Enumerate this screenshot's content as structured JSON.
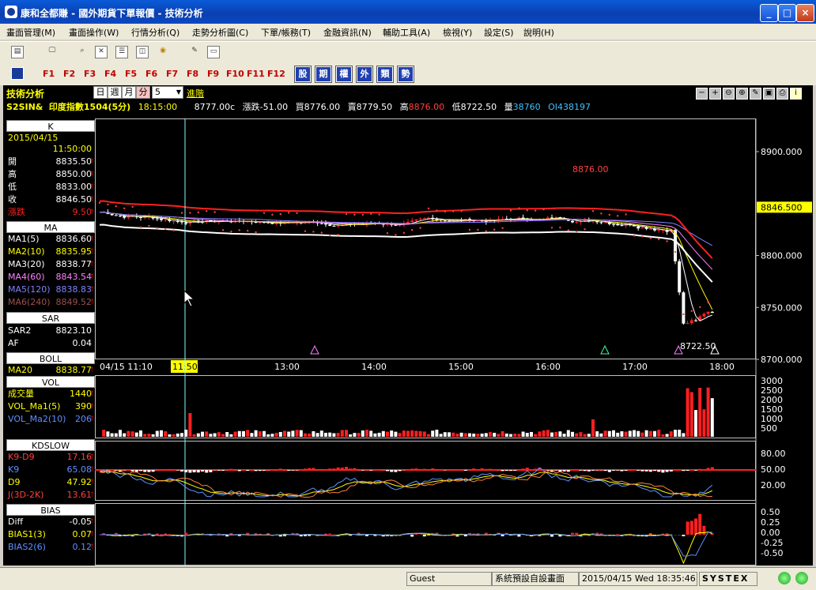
{
  "window": {
    "title": "康和全都賺 - 國外期貨下單報價 - 技術分析",
    "min": "_",
    "max": "□",
    "close": "×"
  },
  "menu": [
    "畫面管理(M)",
    "畫面操作(W)",
    "行情分析(Q)",
    "走勢分析圖(C)",
    "下單/帳務(T)",
    "金融資訊(N)",
    "輔助工具(A)",
    "檢視(Y)",
    "設定(S)",
    "說明(H)"
  ],
  "fkeys": [
    "F1",
    "F2",
    "F3",
    "F4",
    "F5",
    "F6",
    "F7",
    "F8",
    "F9",
    "F10",
    "F11",
    "F12"
  ],
  "char_buttons": [
    "股",
    "期",
    "權",
    "外",
    "類",
    "勢"
  ],
  "chart_header": {
    "title": "技術分析",
    "periods": [
      "日",
      "週",
      "月",
      "分"
    ],
    "period_value": "5",
    "advanced": "進階",
    "symbol": "S2SIN&",
    "name": "印度指數1504(5分)",
    "time": "18:15:00",
    "price": "8777.00c",
    "change": "漲跌-51.00",
    "bid": "買8776.00",
    "ask": "賣8779.50",
    "high_label": "高",
    "high": "8876.00",
    "low": "低8722.50",
    "vol_label": "量",
    "vol": "38760",
    "oi": "OI438197"
  },
  "left_panel": {
    "k": {
      "head": "K",
      "date": "2015/04/15",
      "time": "11:50:00",
      "rows": [
        {
          "k": "開",
          "v": "8835.50"
        },
        {
          "k": "高",
          "v": "8850.00"
        },
        {
          "k": "低",
          "v": "8833.00"
        },
        {
          "k": "收",
          "v": "8846.50"
        },
        {
          "k": "漲跌",
          "v": "9.50"
        }
      ]
    },
    "ma": {
      "head": "MA",
      "rows": [
        {
          "k": "MA1(5)",
          "v": "8836.60",
          "c": "#ffffff"
        },
        {
          "k": "MA2(10)",
          "v": "8835.95",
          "c": "#ffff00"
        },
        {
          "k": "MA3(20)",
          "v": "8838.77",
          "c": "#ffffff"
        },
        {
          "k": "MA4(60)",
          "v": "8843.54",
          "c": "#ff80ff"
        },
        {
          "k": "MA5(120)",
          "v": "8838.83",
          "c": "#8080ff"
        },
        {
          "k": "MA6(240)",
          "v": "8849.52",
          "c": "#a05050"
        }
      ]
    },
    "sar": {
      "head": "SAR",
      "rows": [
        {
          "k": "SAR2",
          "v": "8823.10"
        },
        {
          "k": "AF",
          "v": "0.04"
        }
      ]
    },
    "boll": {
      "head": "BOLL",
      "rows": [
        {
          "k": "MA20",
          "v": "8838.77"
        }
      ]
    },
    "vol": {
      "head": "VOL",
      "rows": [
        {
          "k": "成交量",
          "v": "1440",
          "c": "#ffff00"
        },
        {
          "k": "VOL_Ma1(5)",
          "v": "390",
          "c": "#ffff00"
        },
        {
          "k": "VOL_Ma2(10)",
          "v": "206",
          "c": "#6090ff"
        }
      ]
    },
    "kd": {
      "head": "KDSLOW",
      "rows": [
        {
          "k": "K9-D9",
          "v": "17.16",
          "c": "#ff4040"
        },
        {
          "k": "K9",
          "v": "65.08",
          "c": "#6090ff"
        },
        {
          "k": "D9",
          "v": "47.92",
          "c": "#ffff00"
        },
        {
          "k": "J(3D-2K)",
          "v": "13.61",
          "c": "#ff4040"
        }
      ]
    },
    "bias": {
      "head": "BIAS",
      "rows": [
        {
          "k": "Diff",
          "v": "-0.05",
          "c": "#ffffff"
        },
        {
          "k": "BIAS1(3)",
          "v": "0.07",
          "c": "#ffff00"
        },
        {
          "k": "BIAS2(6)",
          "v": "0.12",
          "c": "#6090ff"
        }
      ]
    }
  },
  "price_chart": {
    "y_ticks": [
      "8900.000",
      "8800.000",
      "8750.000",
      "8700.000"
    ],
    "current": "8846.500",
    "high_label": "8876.00",
    "low_label": "8722.50",
    "x_first": "04/15 11:10",
    "x_cursor": "11:50",
    "x_ticks": [
      "13:00",
      "14:00",
      "15:00",
      "16:00",
      "17:00",
      "18:00"
    ]
  },
  "vol_ticks": [
    "3000",
    "2500",
    "2000",
    "1500",
    "1000",
    "500"
  ],
  "kd_ticks": [
    "80.00",
    "50.00",
    "20.00"
  ],
  "bias_ticks": [
    "0.50",
    "0.25",
    "0.00",
    "-0.25",
    "-0.50"
  ],
  "status": {
    "user": "Guest",
    "layout": "系統預設自設畫面",
    "datetime": "2015/04/15 Wed 18:35:46",
    "brand": "SYSTEX"
  },
  "colors": {
    "up": "#ff2020",
    "down": "#ffffff",
    "sar": "#ff4040",
    "boll": "#ffffff",
    "ma": "#ffff00"
  }
}
